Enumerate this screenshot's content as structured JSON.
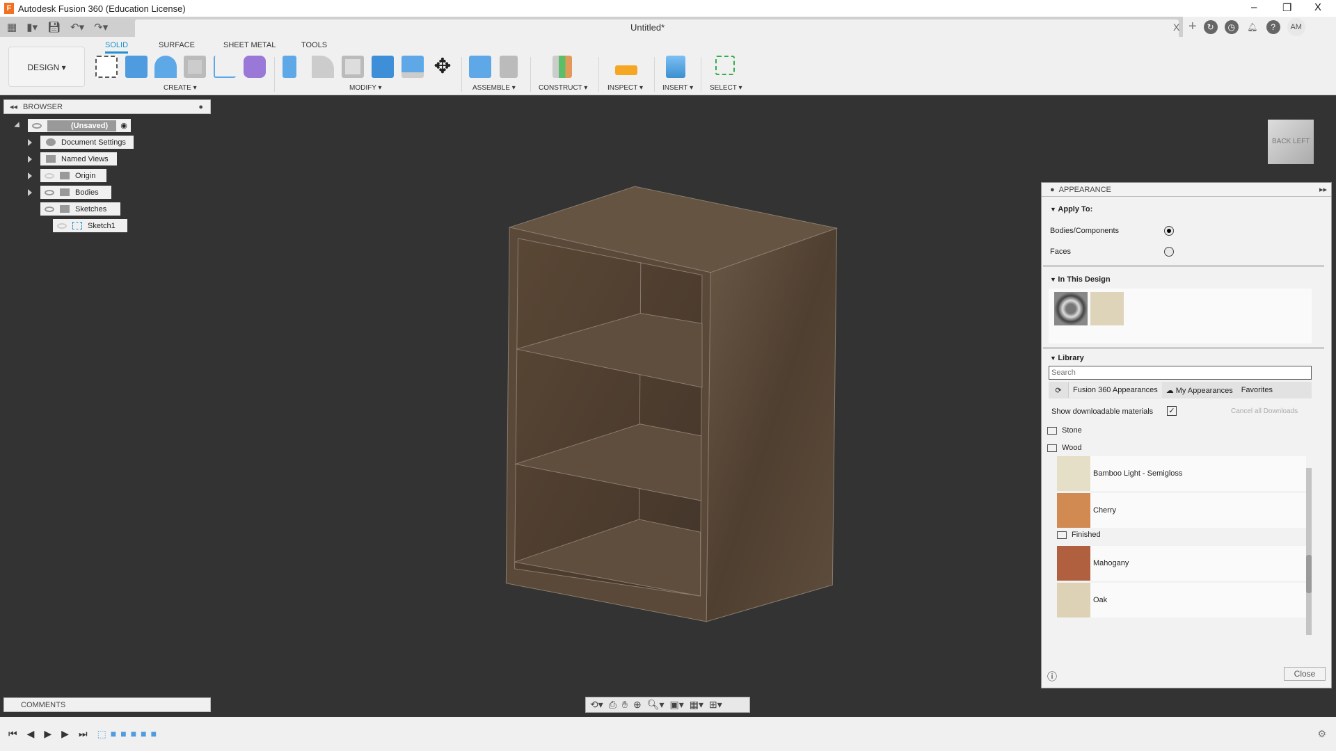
{
  "app": {
    "title": "Autodesk Fusion 360 (Education License)",
    "logo_letter": "F",
    "window_controls": [
      "–",
      "❐",
      "X"
    ]
  },
  "document_tab": {
    "name": "Untitled*",
    "close": "X"
  },
  "top_right": {
    "icons": [
      "plus-icon",
      "extensions-icon",
      "job-status-icon",
      "notifications-icon",
      "help-icon"
    ],
    "user_initials": "AM"
  },
  "workspace": {
    "label": "DESIGN ▾"
  },
  "toolbar_tabs": [
    {
      "label": "SOLID",
      "active": true
    },
    {
      "label": "SURFACE"
    },
    {
      "label": "SHEET METAL"
    },
    {
      "label": "TOOLS"
    }
  ],
  "toolbar_groups": [
    "CREATE ▾",
    "MODIFY ▾",
    "ASSEMBLE ▾",
    "CONSTRUCT ▾",
    "INSPECT ▾",
    "INSERT ▾",
    "SELECT ▾"
  ],
  "browser": {
    "title": "BROWSER",
    "nodes": [
      {
        "label": "(Unsaved)"
      },
      {
        "label": "Document Settings"
      },
      {
        "label": "Named Views"
      },
      {
        "label": "Origin"
      },
      {
        "label": "Bodies"
      },
      {
        "label": "Sketches"
      },
      {
        "label": "Sketch1"
      }
    ]
  },
  "viewcube": {
    "faces": [
      "BACK",
      "LEFT"
    ]
  },
  "appearance": {
    "title": "APPEARANCE",
    "apply_to": {
      "heading": "Apply To:",
      "options": [
        {
          "label": "Bodies/Components",
          "selected": true
        },
        {
          "label": "Faces",
          "selected": false
        }
      ]
    },
    "in_design": {
      "heading": "In This Design"
    },
    "library": {
      "heading": "Library",
      "search_placeholder": "Search",
      "tabs": [
        "Fusion 360 Appearances",
        "My Appearances",
        "Favorites"
      ],
      "show_downloadable": "Show downloadable materials",
      "show_downloadable_checked": true,
      "cancel_downloads": "Cancel all Downloads",
      "folders": [
        "Stone",
        "Wood",
        "Finished"
      ],
      "materials": [
        {
          "name": "Bamboo Light - Semigloss",
          "color": "#e6dfc7"
        },
        {
          "name": "Cherry",
          "color": "#d08a52"
        },
        {
          "name": "Mahogany",
          "color": "#b0603f"
        },
        {
          "name": "Oak",
          "color": "#ddd2b6"
        }
      ]
    },
    "close": "Close"
  },
  "comments": {
    "title": "COMMENTS"
  },
  "colors": {
    "accent": "#1d91d1",
    "canvas": "#333333",
    "wood": "#5b4a38"
  }
}
